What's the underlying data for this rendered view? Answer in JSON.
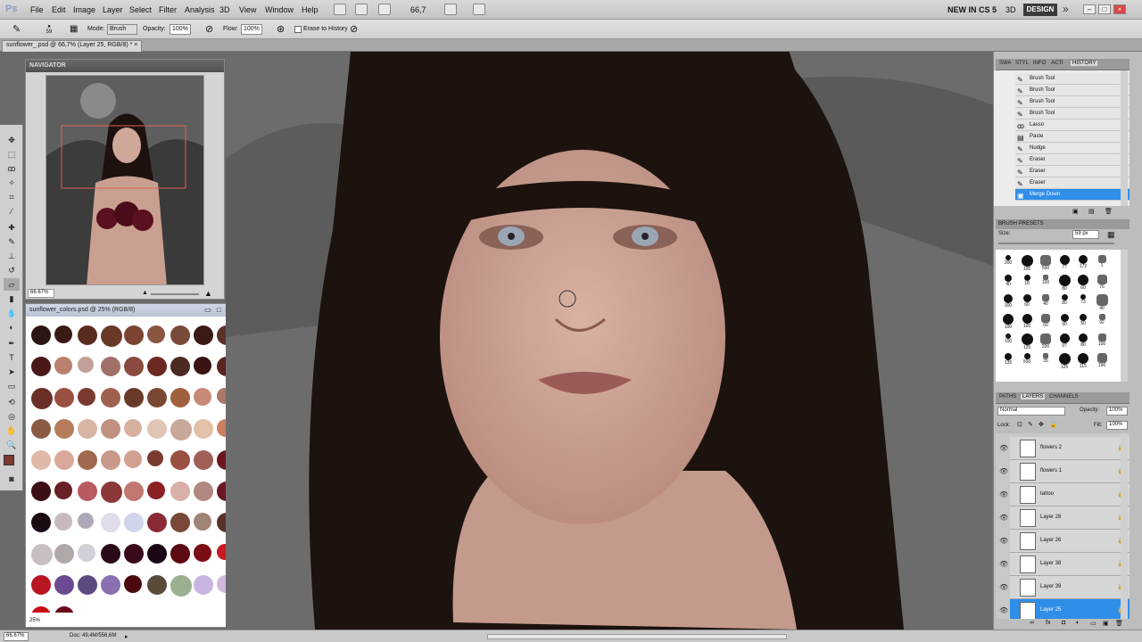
{
  "app_logo": "Ps",
  "menu": [
    "File",
    "Edit",
    "Image",
    "Layer",
    "Select",
    "Filter",
    "Analysis",
    "3D",
    "View",
    "Window",
    "Help"
  ],
  "zoom_level": "66,7",
  "new_in_cs5": "NEW IN CS 5",
  "workspace_3d": "3D",
  "workspace_design": "DESIGN",
  "options": {
    "brush_size": "59",
    "mode_label": "Mode:",
    "mode_value": "Brush",
    "opacity_label": "Opacity:",
    "opacity_value": "100%",
    "flow_label": "Flow:",
    "flow_value": "100%",
    "erase_to_history": "Erase to History"
  },
  "document_tab": "sunflower_.psd @ 66,7% (Layer 25, RGB/8) *",
  "navigator": {
    "title": "NAVIGATOR",
    "zoom": "66.67%"
  },
  "colors_window": {
    "title": "sunflower_colors.psd @ 25% (RGB/8)",
    "zoom": "25%",
    "swatches": [
      "#2a1612",
      "#3a1a14",
      "#5a2b20",
      "#6a3826",
      "#7a4430",
      "#8a5640",
      "#7a4a38",
      "#3a1a14",
      "#5a3028",
      "#4a1a1a",
      "#b98070",
      "#c0a098",
      "#a07068",
      "#8a4a40",
      "#6a2a22",
      "#4a2a22",
      "#3a1412",
      "#5a2420",
      "#6a3028",
      "#9a5040",
      "#7a3a30",
      "#a06050",
      "#6a3a28",
      "#7a4832",
      "#a06040",
      "#c88a78",
      "#a87868",
      "#8a5a44",
      "#b47c5a",
      "#d8b4a4",
      "#c09080",
      "#d8b0a0",
      "#e0c4b4",
      "#c8a898",
      "#e4c0a8",
      "#c88060",
      "#e0b8a8",
      "#d8a898",
      "#a06850",
      "#c89888",
      "#d0a090",
      "#7a3a30",
      "#9a5040",
      "#a06058",
      "#6a1820",
      "#3a1016",
      "#6a2024",
      "#b85a60",
      "#8a3838",
      "#c07870",
      "#8a2024",
      "#d8b0a8",
      "#b08880",
      "#6a1828",
      "#1a0a14",
      "#c8b8c0",
      "#b0a8b8",
      "#e0dcea",
      "#d0d4ec",
      "#8a2a34",
      "#7a4838",
      "#a08478",
      "#5a3028",
      "#c8c0c0",
      "#b0a8a8",
      "#d0d0d8",
      "#2a0a18",
      "#3a0a1c",
      "#1a0614",
      "#5a0a10",
      "#7a0e14",
      "#c81c22",
      "#b81620",
      "#6a4a90",
      "#5a4a80",
      "#8a70b0",
      "#4a0a10",
      "#5a4a3a",
      "#9ab090",
      "#c8b4e0",
      "#d0b8e0",
      "#c81018",
      "#6a0a18"
    ]
  },
  "panels": {
    "history_tabs": [
      "SWA",
      "STYL",
      "INFO",
      "ACTI",
      "HISTORY"
    ],
    "history": [
      {
        "label": "Brush Tool",
        "icon": "brush-icon"
      },
      {
        "label": "Brush Tool",
        "icon": "brush-icon"
      },
      {
        "label": "Brush Tool",
        "icon": "brush-icon"
      },
      {
        "label": "Brush Tool",
        "icon": "brush-icon"
      },
      {
        "label": "Lasso",
        "icon": "lasso-icon"
      },
      {
        "label": "Paste",
        "icon": "paste-icon"
      },
      {
        "label": "Nudge",
        "icon": "nudge-icon"
      },
      {
        "label": "Eraser",
        "icon": "eraser-icon"
      },
      {
        "label": "Eraser",
        "icon": "eraser-icon"
      },
      {
        "label": "Eraser",
        "icon": "eraser-icon"
      },
      {
        "label": "Merge Down",
        "icon": "merge-icon"
      }
    ],
    "brush_presets_title": "BRUSH PRESETS",
    "brush_size_label": "Size:",
    "brush_size_value": "59 px",
    "brush_sizes": [
      "200",
      "100",
      "500",
      "77",
      "172",
      "1",
      "40",
      "18",
      "100",
      "80",
      "60",
      "75",
      "300",
      "60",
      "40",
      "80",
      "73",
      "40",
      "100",
      "100",
      "60",
      "90",
      "50",
      "92",
      "100",
      "125",
      "200",
      "97",
      "80",
      "100",
      "135",
      "500",
      "35",
      "125",
      "115",
      "196"
    ],
    "layers_tabs": [
      "PATHS",
      "LAYERS",
      "CHANNELS"
    ],
    "blend_mode": "Normal",
    "layer_opacity_label": "Opacity:",
    "layer_opacity": "100%",
    "lock_label": "Lock:",
    "fill_label": "Fill:",
    "fill_value": "100%",
    "layers": [
      "flowers 2",
      "flowers 1",
      "tattoo",
      "Layer 28",
      "Layer 26",
      "Layer 38",
      "Layer 39",
      "Layer 25"
    ]
  },
  "status": {
    "zoom": "66.67%",
    "doc": "Doc: 49,4M/556,6M"
  }
}
